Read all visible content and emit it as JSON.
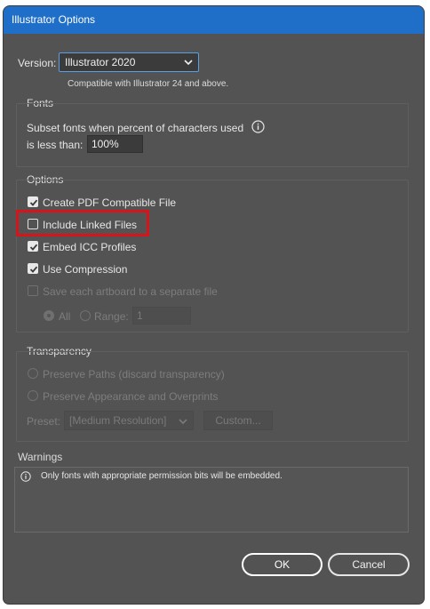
{
  "window": {
    "title": "Illustrator Options"
  },
  "version": {
    "label": "Version:",
    "selected": "Illustrator 2020",
    "note": "Compatible with Illustrator 24 and above."
  },
  "fonts": {
    "title": "Fonts",
    "subset_line1": "Subset fonts when percent of characters used",
    "subset_line2": "is less than:",
    "percent": "100%",
    "info_icon": "info-icon"
  },
  "options": {
    "title": "Options",
    "create_pdf": {
      "label": "Create PDF Compatible File",
      "checked": true
    },
    "include_linked": {
      "label": "Include Linked Files",
      "checked": false
    },
    "embed_icc": {
      "label": "Embed ICC Profiles",
      "checked": true
    },
    "use_compression": {
      "label": "Use Compression",
      "checked": true
    },
    "save_each_artboard": {
      "label": "Save each artboard to a separate file",
      "checked": false,
      "enabled": false
    },
    "all_label": "All",
    "range_label": "Range:",
    "range_value": "1"
  },
  "transparency": {
    "title": "Transparency",
    "preserve_paths": "Preserve Paths (discard transparency)",
    "preserve_appearance": "Preserve Appearance and Overprints",
    "preset_label": "Preset:",
    "preset_value": "[Medium Resolution]",
    "custom_label": "Custom..."
  },
  "warnings": {
    "title": "Warnings",
    "message": "Only fonts with appropriate permission bits will be embedded."
  },
  "buttons": {
    "ok": "OK",
    "cancel": "Cancel"
  },
  "colors": {
    "titlebar": "#1f6fc9",
    "panel": "#535353",
    "highlight": "#d7141a"
  }
}
